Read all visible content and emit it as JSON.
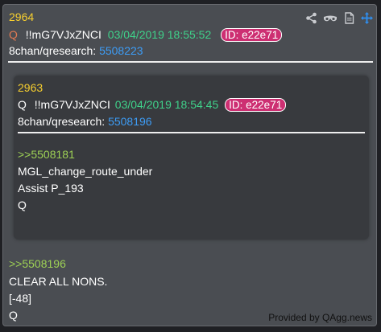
{
  "post": {
    "number": "2964",
    "q_glyph": "Q",
    "tripcode": "!!mG7VJxZNCI",
    "timestamp": "03/04/2019 18:55:52",
    "id_badge": "ID: e22e71",
    "board": "8chan/qresearch:",
    "post_link": "5508223",
    "reply_link": ">>5508196",
    "body_lines": [
      "CLEAR ALL NONS.",
      "[-48]",
      "Q"
    ]
  },
  "quoted_post": {
    "number": "2963",
    "q_glyph": "Q",
    "tripcode": "!!mG7VJxZNCI",
    "timestamp": "03/04/2019 18:54:45",
    "id_badge": "ID: e22e71",
    "board": "8chan/qresearch:",
    "post_link": "5508196",
    "reply_link": ">>5508181",
    "body_lines": [
      "MGL_change_route_under",
      "Assist P_193",
      "Q"
    ]
  },
  "toolbar": {
    "icons": [
      "share-icon",
      "glasses-icon",
      "document-icon",
      "move-icon"
    ]
  },
  "credit": "Provided by QAgg.news",
  "colors": {
    "card_bg": "#4a4d52",
    "inner_bg": "#383a3e",
    "post_number": "#f7cf2f",
    "timestamp": "#3fd18a",
    "id_badge": "#cd2f72",
    "link": "#3d9cf5",
    "reply_link": "#9ed155"
  }
}
